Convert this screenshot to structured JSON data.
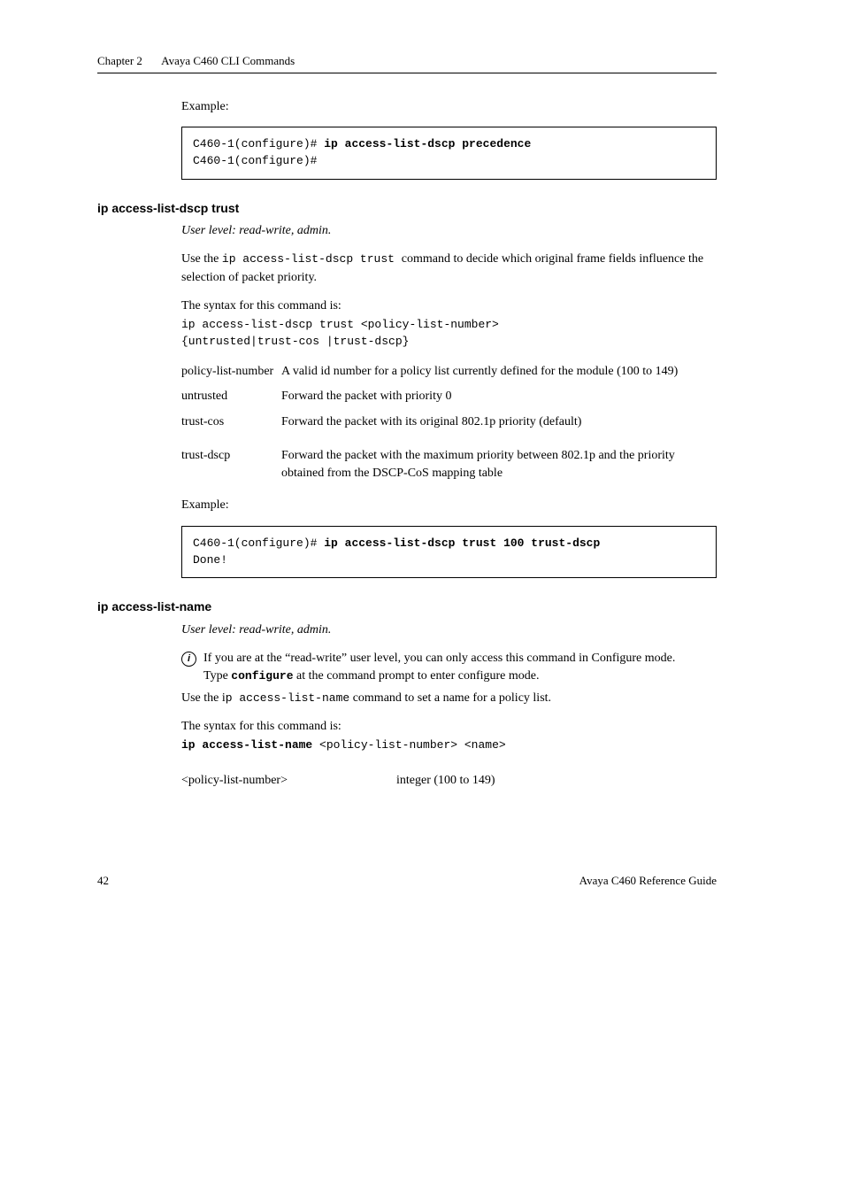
{
  "header": {
    "left": "Chapter 2",
    "right": "Avaya C460 CLI Commands"
  },
  "sec0": {
    "example_label": "Example:",
    "code": "C460-1(configure)# ",
    "code_bold": "ip access-list-dscp precedence",
    "code2": "C460-1(configure)#"
  },
  "sec1": {
    "title": "ip access-list-dscp trust",
    "userlevel": "User level: read-write, admin.",
    "intro_pre": "Use the ",
    "intro_mono": "ip access-list-dscp trust ",
    "intro_post": " command to decide which original frame fields influence the selection of  packet priority.",
    "syntax_label": "The syntax for this command is:",
    "syntax1": "ip access-list-dscp trust <policy-list-number>",
    "syntax2": "{untrusted|trust-cos |trust-dscp}",
    "params": [
      {
        "k": "policy-list-number",
        "v": "A valid id number for a policy list currently defined for the module (100 to 149)"
      },
      {
        "k": "untrusted",
        "v": "Forward the packet with priority 0"
      },
      {
        "k": "trust-cos",
        "v": "Forward the packet with its original 802.1p priority (default)"
      },
      {
        "k": "trust-dscp",
        "v": "Forward the packet with the maximum priority between 802.1p and the priority obtained from the DSCP-CoS mapping table"
      }
    ],
    "example_label": "Example:",
    "code": "C460-1(configure)# ",
    "code_bold": "ip access-list-dscp trust 100 trust-dscp",
    "code2": "Done!"
  },
  "sec2": {
    "title": "ip access-list-name",
    "userlevel": "User level: read-write, admin.",
    "info1": "If you are at the “read-write” user level, you can only access this command in Configure mode.",
    "info2_pre": "Type ",
    "info2_bold": "configure",
    "info2_post": " at the command prompt to enter configure mode.",
    "intro_pre": "Use the i",
    "intro_mono": "p access-list-name",
    "intro_post": " command to set a name for a policy list.",
    "syntax_label": "The syntax for this command is:",
    "syntax_bold": "ip access-list-name",
    "syntax_rest": " <policy-list-number> <name>",
    "params": [
      {
        "k": "<policy-list-number>",
        "v": "integer (100 to 149)"
      }
    ]
  },
  "footer": {
    "page": "42",
    "right": "Avaya C460 Reference Guide"
  }
}
